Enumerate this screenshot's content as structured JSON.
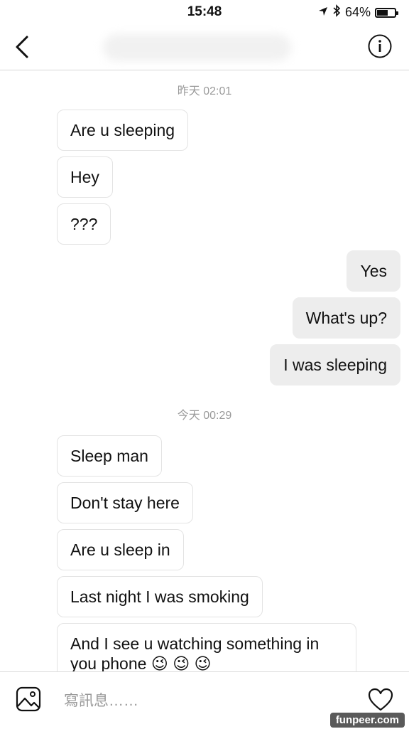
{
  "status": {
    "time": "15:48",
    "battery": "64%",
    "battery_level": 0.64
  },
  "nav": {
    "back_icon": "chevron-left-icon",
    "info_icon": "info-icon"
  },
  "messages": {
    "ts1": "昨天 02:01",
    "ts2": "今天 00:29",
    "m1": "Are u sleeping",
    "m2": "Hey",
    "m3": "???",
    "m4": "Yes",
    "m5": "What's up?",
    "m6": "I was sleeping",
    "m7": "Sleep man",
    "m8": "Don't stay here",
    "m9": "Are u sleep in",
    "m10": "Last night I was smoking",
    "m11": "And I see u watching something in you phone 😉 😉 😉"
  },
  "composer": {
    "placeholder": "寫訊息……",
    "gallery_icon": "image-icon",
    "heart_icon": "heart-icon"
  },
  "watermark": "funpeer.com"
}
